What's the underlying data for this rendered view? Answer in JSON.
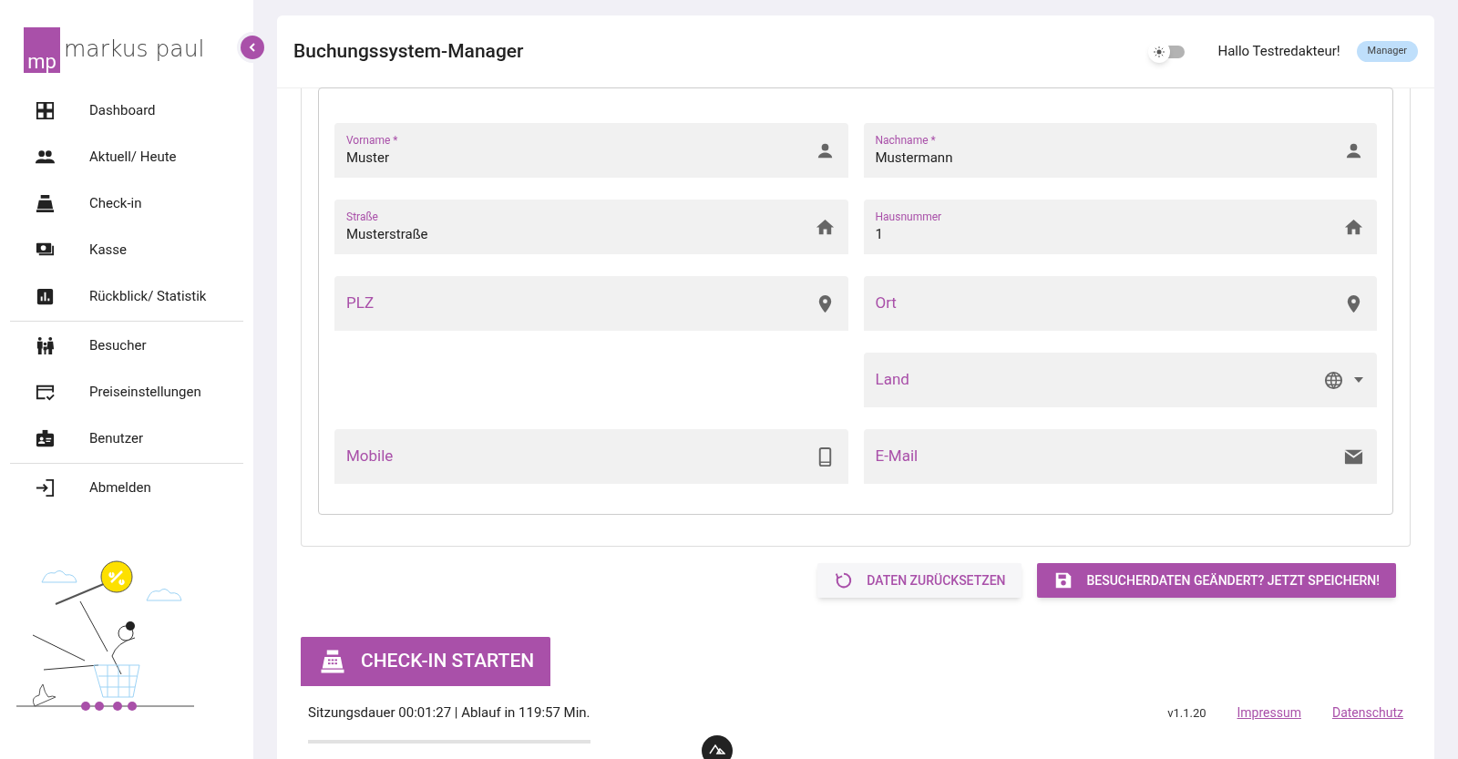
{
  "brand": {
    "logo_mark": "mp",
    "name": "markus paul"
  },
  "sidebar": {
    "groups": [
      {
        "items": [
          {
            "label": "Dashboard"
          },
          {
            "label": "Aktuell/ Heute"
          },
          {
            "label": "Check-in"
          },
          {
            "label": "Kasse"
          },
          {
            "label": "Rückblick/ Statistik"
          }
        ]
      },
      {
        "items": [
          {
            "label": "Besucher"
          },
          {
            "label": "Preiseinstellungen"
          },
          {
            "label": "Benutzer"
          }
        ]
      },
      {
        "items": [
          {
            "label": "Abmelden"
          }
        ]
      }
    ]
  },
  "header": {
    "title": "Buchungssystem-Manager",
    "dark_mode": false,
    "greeting": "Hallo Testredakteur!",
    "role": "Manager"
  },
  "form": {
    "rows": [
      {
        "left": {
          "label": "Vorname *",
          "value": "Muster",
          "kind": "name"
        },
        "right": {
          "label": "Nachname *",
          "value": "Mustermann",
          "kind": "name"
        }
      },
      {
        "left": {
          "label": "Straße",
          "value": "Musterstraße",
          "kind": "address"
        },
        "right": {
          "label": "Hausnummer",
          "value": "1",
          "kind": "address"
        }
      },
      {
        "left": {
          "label": "PLZ",
          "kind": "place"
        },
        "right": {
          "label": "Ort",
          "kind": "place"
        }
      },
      {
        "right": {
          "label": "Land",
          "kind": "country"
        }
      },
      {
        "left": {
          "label": "Mobile",
          "kind": "phone"
        },
        "right": {
          "label": "E-Mail",
          "kind": "email"
        }
      }
    ]
  },
  "actions": [
    {
      "label": "DATEN ZURÜCKSETZEN",
      "kind": "reset"
    },
    {
      "label": "BESUCHERDATEN GEÄNDERT? JETZT SPEICHERN!",
      "kind": "save"
    }
  ],
  "checkin_button": "CHECK-IN STARTEN",
  "footer": {
    "session": "Sitzungsdauer 00:01:27 | Ablauf in 119:57 Min.",
    "version": "v1.1.20",
    "links": [
      "Impressum",
      "Datenschutz"
    ]
  }
}
